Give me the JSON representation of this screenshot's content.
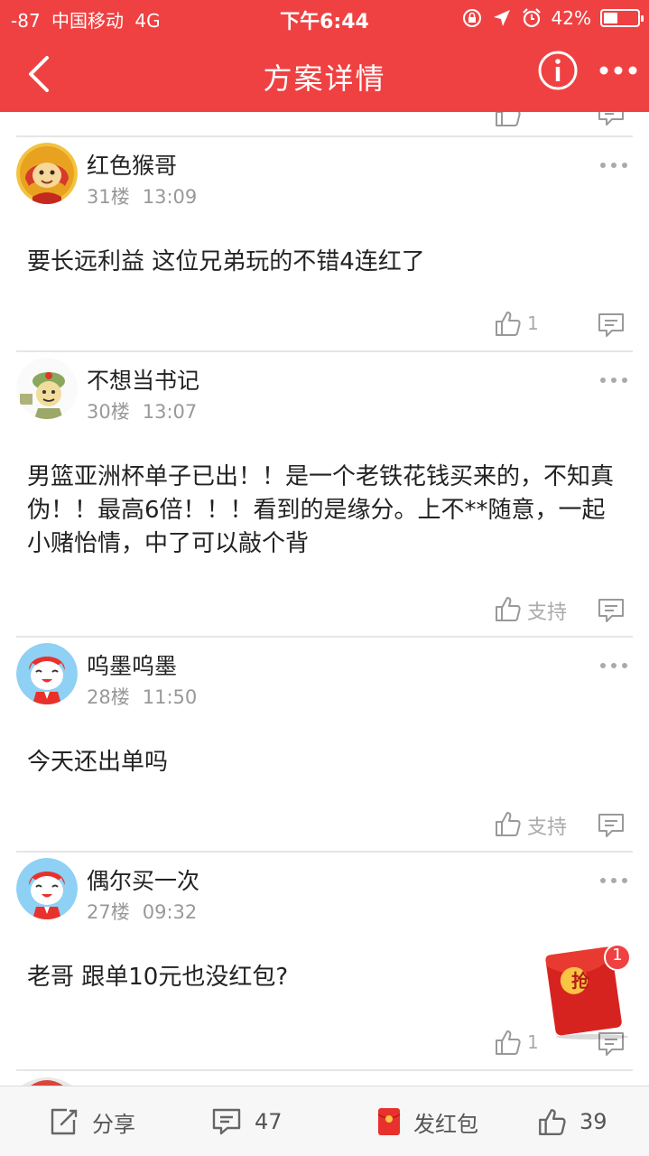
{
  "status_bar": {
    "signal": "-87",
    "carrier": "中国移动",
    "network": "4G",
    "time": "下午6:44",
    "battery_percent": "42%",
    "battery_level": 0.42,
    "icons": [
      "lock-rotation-icon",
      "location-arrow-icon",
      "alarm-icon"
    ]
  },
  "nav": {
    "title": "方案详情",
    "back_icon": "back-chevron-icon",
    "info_icon": "info-icon",
    "more_icon": "more-dots-icon"
  },
  "comments": [
    {
      "username": "红色猴哥",
      "floor": "31楼",
      "time": "13:09",
      "text": "要长远利益 这位兄弟玩的不错4连红了",
      "like_label": "1",
      "avatar": "monkey-avatar"
    },
    {
      "username": "不想当书记",
      "floor": "30楼",
      "time": "13:07",
      "text": "男篮亚洲杯单子已出！！是一个老铁花钱买来的，不知真伪！！最高6倍！！！看到的是缘分。上不**随意，一起小赌怡情，中了可以敲个背",
      "like_label": "支持",
      "avatar": "cartoon-avatar"
    },
    {
      "username": "呜墨呜墨",
      "floor": "28楼",
      "time": "11:50",
      "text": "今天还出单吗",
      "like_label": "支持",
      "avatar": "default-avatar"
    },
    {
      "username": "偶尔买一次",
      "floor": "27楼",
      "time": "09:32",
      "text": "老哥 跟单10元也没红包?",
      "like_label": "1",
      "avatar": "default-avatar"
    }
  ],
  "red_packet": {
    "char": "抢",
    "badge": "1"
  },
  "bottom_bar": {
    "share_label": "分享",
    "comment_count": "47",
    "red_packet_label": "发红包",
    "like_count": "39"
  },
  "colors": {
    "brand_red": "#f04142",
    "muted_text": "#999999",
    "divider": "#e6e6e6"
  }
}
